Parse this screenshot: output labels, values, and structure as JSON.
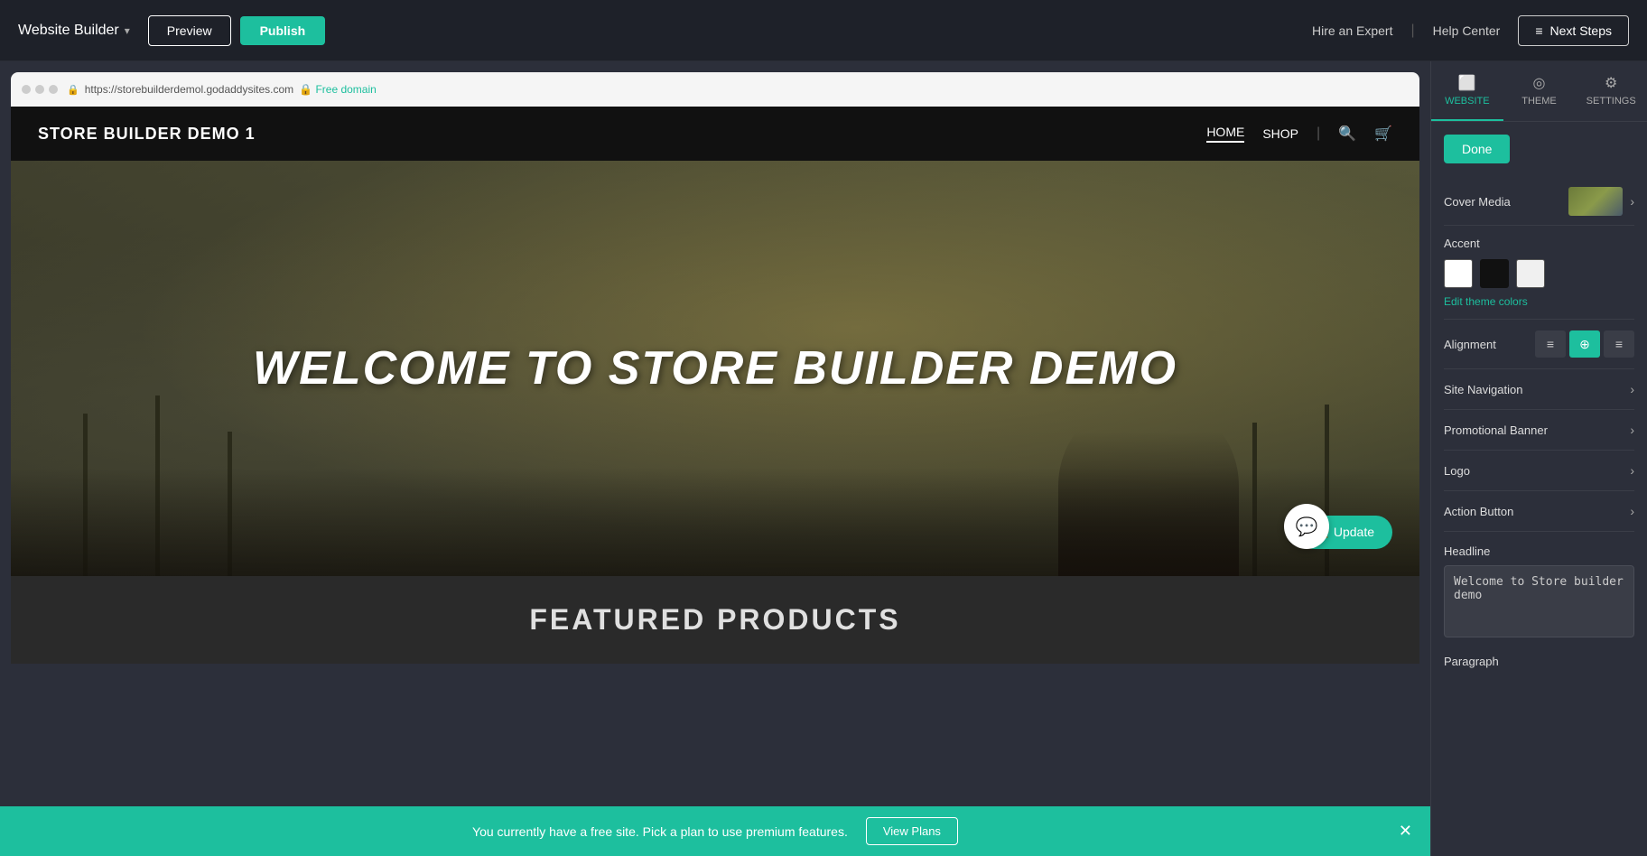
{
  "app": {
    "brand": "Website Builder",
    "brand_chevron": "▾",
    "preview_label": "Preview",
    "publish_label": "Publish",
    "hire_expert": "Hire an Expert",
    "help_center": "Help Center",
    "next_steps_label": "Next Steps",
    "next_steps_icon": "≡"
  },
  "top_bar": {
    "divider": "|"
  },
  "browser": {
    "url": "https://storebuilderdemol.godaddysites.com",
    "free_domain": "🔒 Free domain"
  },
  "site": {
    "logo": "STORE BUILDER DEMO 1",
    "nav_home": "HOME",
    "nav_shop": "SHOP",
    "hero_title": "WELCOME TO STORE BUILDER DEMO",
    "update_label": "🏠 Update",
    "featured_title": "FEATURED PRODUCTS"
  },
  "banner": {
    "text": "You currently have a free site. Pick a plan to use premium features.",
    "view_plans": "View Plans",
    "close": "✕"
  },
  "panel": {
    "tabs": [
      {
        "id": "website",
        "label": "WEBSITE",
        "icon": "⬜"
      },
      {
        "id": "theme",
        "label": "THEME",
        "icon": "◎"
      },
      {
        "id": "settings",
        "label": "SETTINGS",
        "icon": "⚙"
      }
    ],
    "active_tab": "website",
    "done_label": "Done",
    "cover_media_label": "Cover Media",
    "accent_label": "Accent",
    "edit_theme_colors": "Edit theme colors",
    "alignment_label": "Alignment",
    "alignment_options": [
      "left",
      "center",
      "right"
    ],
    "accent_colors": [
      "#ffffff",
      "#111111",
      "#f0f0f0"
    ],
    "sections": [
      {
        "id": "site-navigation",
        "label": "Site Navigation"
      },
      {
        "id": "promotional-banner",
        "label": "Promotional Banner"
      },
      {
        "id": "logo",
        "label": "Logo"
      },
      {
        "id": "action-button",
        "label": "Action Button"
      }
    ],
    "headline_label": "Headline",
    "headline_value": "Welcome to Store builder demo",
    "paragraph_label": "Paragraph"
  }
}
